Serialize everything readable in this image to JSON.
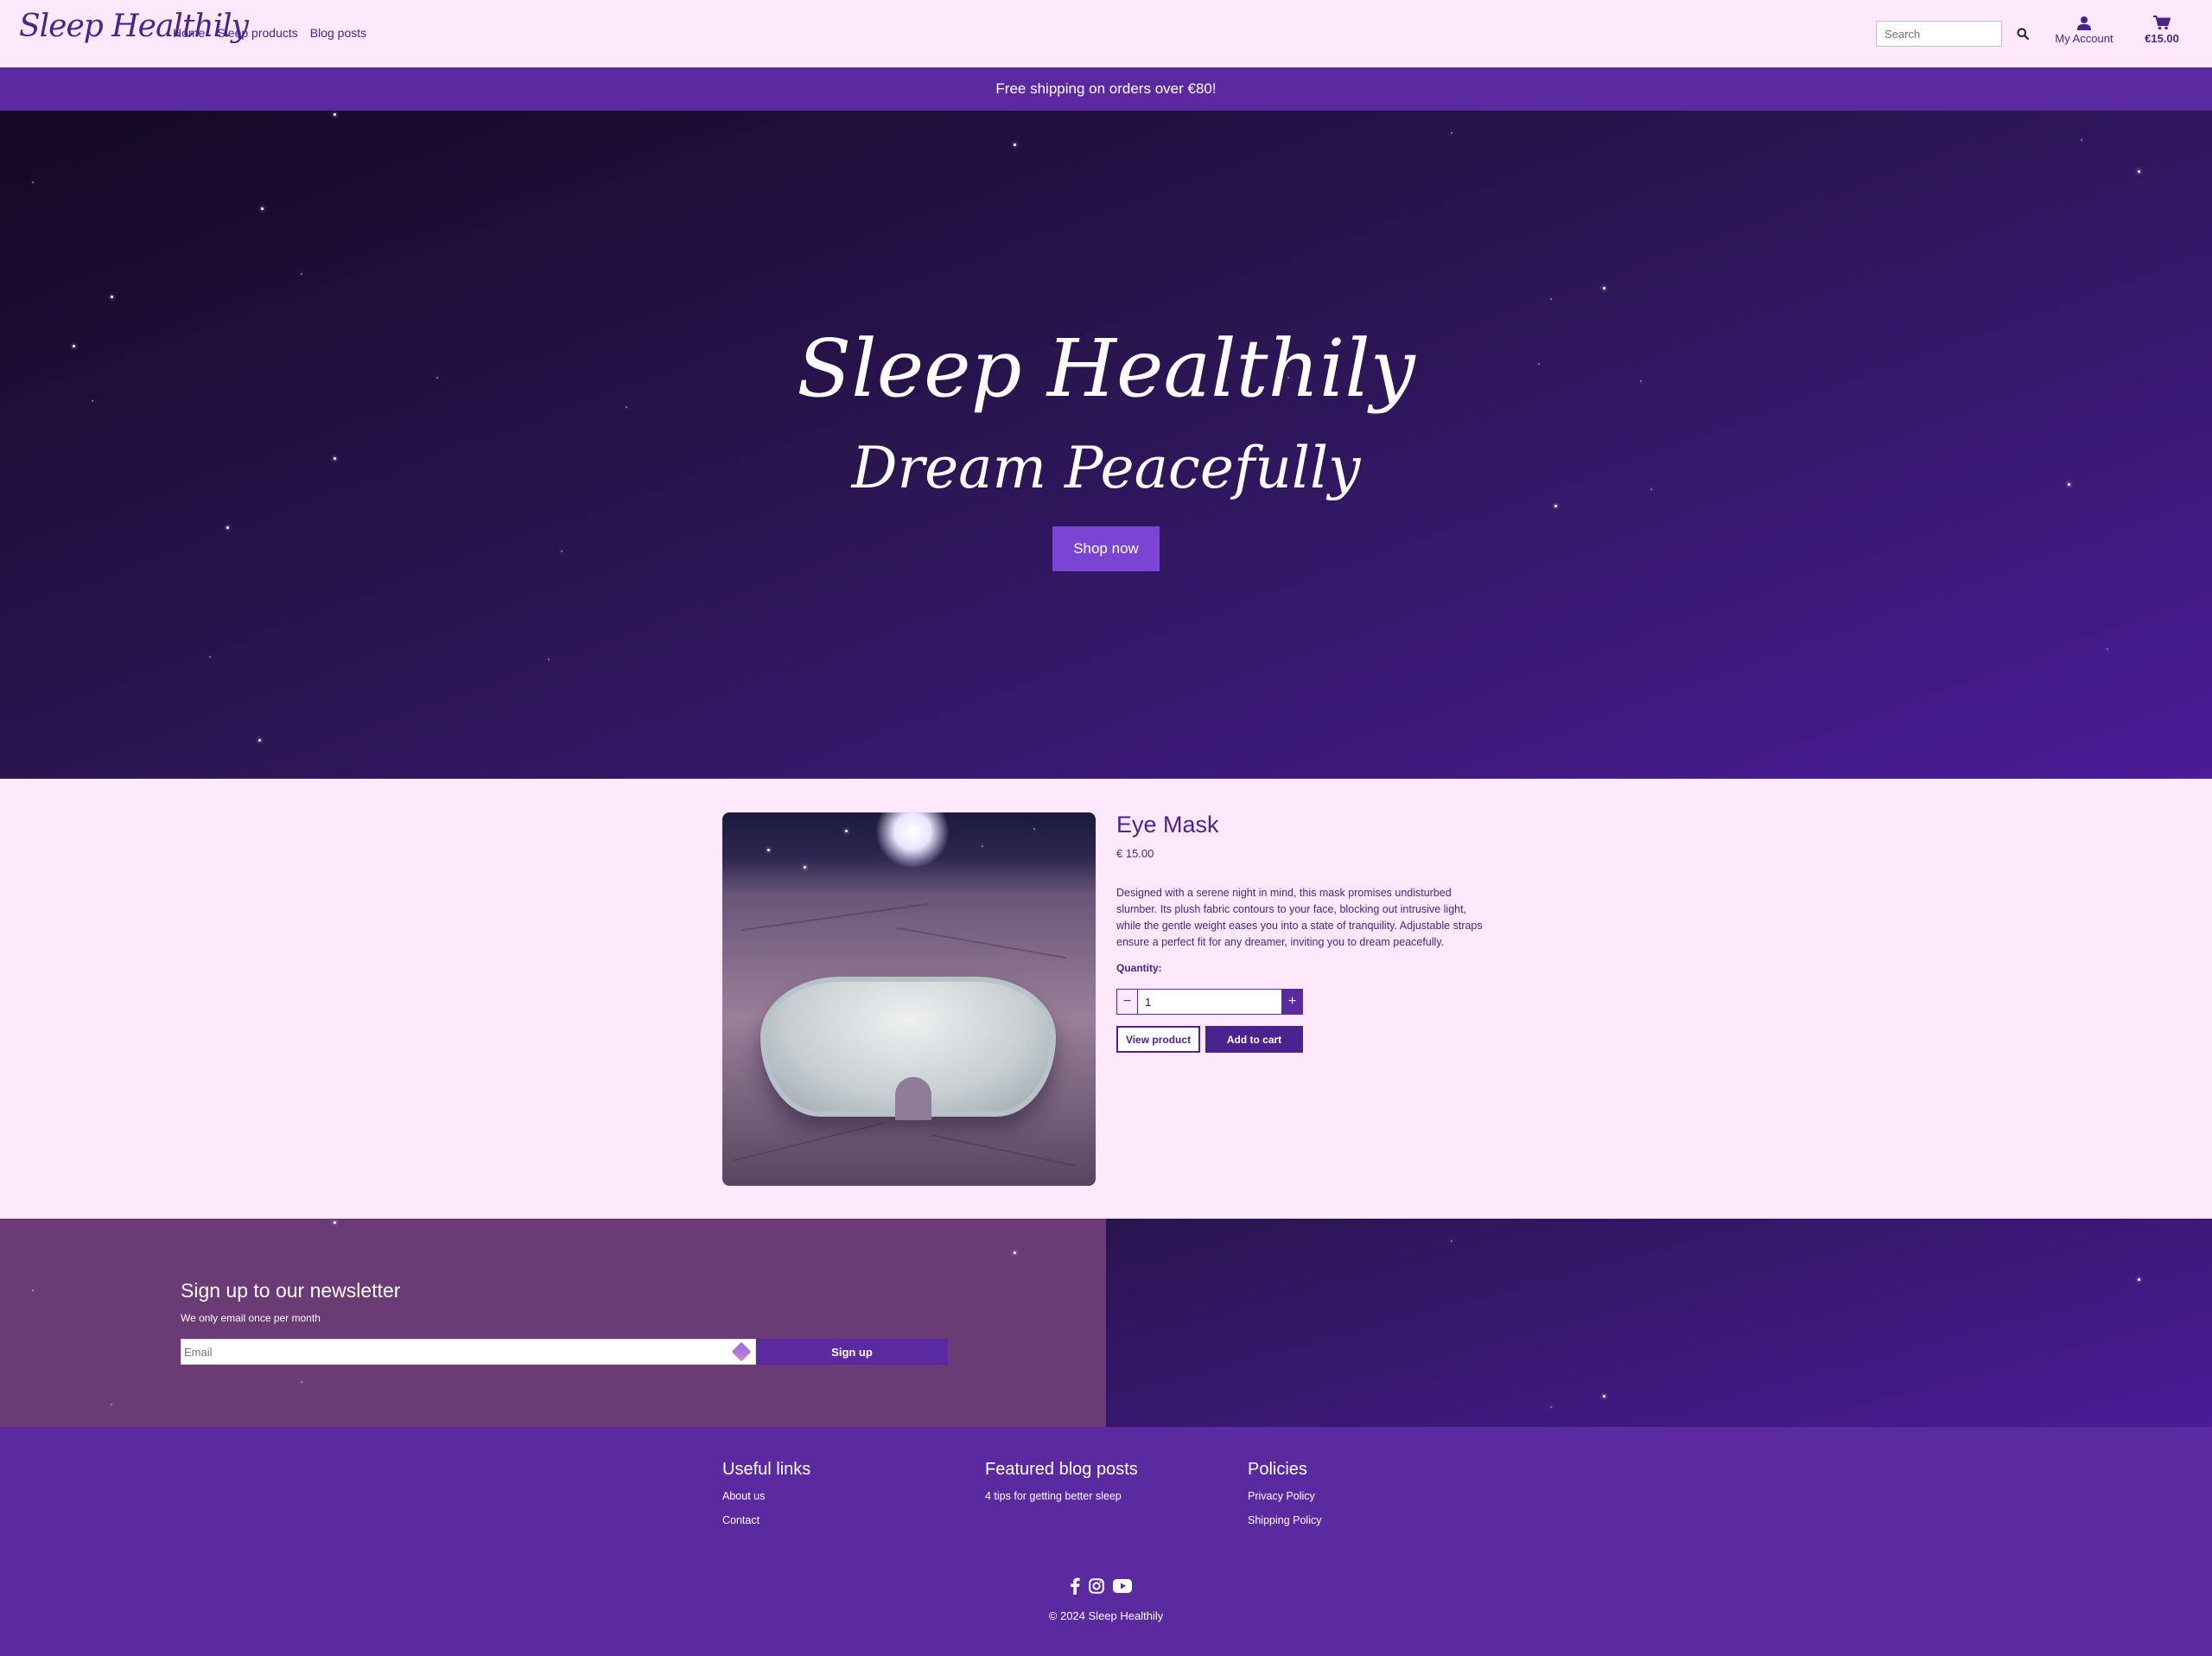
{
  "header": {
    "logo": "Sleep Healthily",
    "nav": [
      "Home",
      "Sleep products",
      "Blog posts"
    ],
    "search_placeholder": "Search",
    "account_label": "My Account",
    "cart_total": "€15.00"
  },
  "banner": {
    "text": "Free shipping on orders over €80!"
  },
  "hero": {
    "title": "Sleep Healthily",
    "subtitle": "Dream Peacefully",
    "cta": "Shop now"
  },
  "product": {
    "title": "Eye Mask",
    "price": "€ 15.00",
    "description": "Designed with a serene night in mind, this mask promises undisturbed slumber. Its plush fabric contours to your face, blocking out intrusive light, while the gentle weight eases you into a state of tranquility. Adjustable straps ensure a perfect fit for any dreamer, inviting you to dream peacefully.",
    "quantity_label": "Quantity:",
    "quantity_value": "1",
    "minus": "−",
    "plus": "+",
    "view_label": "View product",
    "add_label": "Add to cart"
  },
  "newsletter": {
    "title": "Sign up to our newsletter",
    "subtitle": "We only email once per month",
    "email_placeholder": "Email",
    "button": "Sign up"
  },
  "footer": {
    "columns": [
      {
        "title": "Useful links",
        "links": [
          "About us",
          "Contact"
        ]
      },
      {
        "title": "Featured blog posts",
        "links": [
          "4 tips for getting better sleep"
        ]
      },
      {
        "title": "Policies",
        "links": [
          "Privacy Policy",
          "Shipping Policy"
        ]
      }
    ],
    "socials": [
      "facebook-icon",
      "instagram-icon",
      "youtube-icon"
    ],
    "copyright": "© 2024 Sleep Healthily"
  },
  "colors": {
    "brand": "#4b238f",
    "banner": "#5b2aa0",
    "cta": "#7b44d4",
    "page_bg": "#fde9fb",
    "newsletter_left": "#6a3b74"
  }
}
